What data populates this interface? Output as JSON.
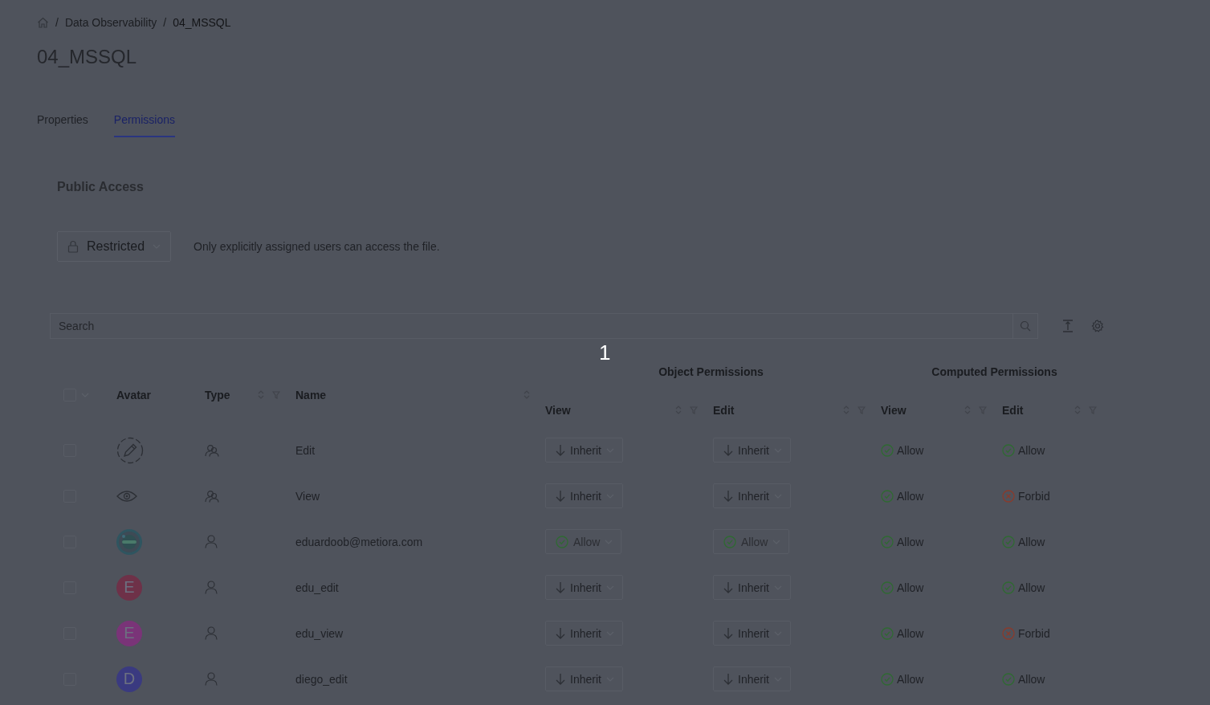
{
  "breadcrumb": [
    {
      "separator": "/",
      "label": "Data Observability"
    },
    {
      "separator": "/",
      "label": "04_MSSQL"
    }
  ],
  "title": "04_MSSQL",
  "tabs": [
    {
      "label": "Properties",
      "selected": false
    },
    {
      "label": "Permissions",
      "selected": true
    }
  ],
  "public_access": {
    "heading": "Public Access",
    "dropdown": {
      "value": "Restricted"
    },
    "description": "Only explicitly assigned users can access the file."
  },
  "search": {
    "placeholder": "Search"
  },
  "step_marker": "1",
  "table": {
    "select_all": {
      "checked": false
    },
    "columns": {
      "avatar": "Avatar",
      "type": "Type",
      "name": "Name"
    },
    "groups": [
      {
        "label": "Object Permissions",
        "columns": [
          "View",
          "Edit"
        ]
      },
      {
        "label": "Computed Permissions",
        "columns": [
          "View",
          "Edit"
        ]
      }
    ],
    "rows": [
      {
        "checked": false,
        "avatar": {
          "kind": "edit"
        },
        "kind": "group",
        "name": "Edit",
        "object": [
          {
            "kind": "inherit",
            "label": "Inherit",
            "disabled": false
          },
          {
            "kind": "inherit",
            "label": "Inherit",
            "disabled": false
          }
        ],
        "computed": [
          {
            "kind": "allow",
            "label": "Allow"
          },
          {
            "kind": "allow",
            "label": "Allow"
          }
        ]
      },
      {
        "checked": false,
        "avatar": {
          "kind": "view"
        },
        "kind": "group",
        "name": "View",
        "object": [
          {
            "kind": "inherit",
            "label": "Inherit",
            "disabled": false
          },
          {
            "kind": "inherit",
            "label": "Inherit",
            "disabled": false
          }
        ],
        "computed": [
          {
            "kind": "allow",
            "label": "Allow"
          },
          {
            "kind": "forbid",
            "label": "Forbid"
          }
        ]
      },
      {
        "checked": false,
        "kind": "user",
        "name": "eduardoob@metiora.com",
        "object": [
          {
            "kind": "allow",
            "label": "Allow",
            "disabled": true
          },
          {
            "kind": "allow",
            "label": "Allow",
            "disabled": true
          }
        ],
        "computed": [
          {
            "kind": "allow",
            "label": "Allow"
          },
          {
            "kind": "allow",
            "label": "Allow"
          }
        ]
      },
      {
        "checked": false,
        "avatar": {
          "kind": "letter",
          "letter": "E",
          "color": "#6e3148"
        },
        "kind": "user",
        "name": "edu_edit",
        "object": [
          {
            "kind": "inherit",
            "label": "Inherit",
            "disabled": false
          },
          {
            "kind": "inherit",
            "label": "Inherit",
            "disabled": false
          }
        ],
        "computed": [
          {
            "kind": "allow",
            "label": "Allow"
          },
          {
            "kind": "allow",
            "label": "Allow"
          }
        ]
      },
      {
        "checked": false,
        "avatar": {
          "kind": "letter",
          "letter": "E",
          "color": "#7a3478"
        },
        "kind": "user",
        "name": "edu_view",
        "object": [
          {
            "kind": "inherit",
            "label": "Inherit",
            "disabled": false
          },
          {
            "kind": "inherit",
            "label": "Inherit",
            "disabled": false
          }
        ],
        "computed": [
          {
            "kind": "allow",
            "label": "Allow"
          },
          {
            "kind": "forbid",
            "label": "Forbid"
          }
        ]
      },
      {
        "checked": false,
        "avatar": {
          "kind": "letter",
          "letter": "D",
          "color": "#3a3a80"
        },
        "kind": "user",
        "name": "diego_edit",
        "object": [
          {
            "kind": "inherit",
            "label": "Inherit",
            "disabled": false
          },
          {
            "kind": "inherit",
            "label": "Inherit",
            "disabled": false
          }
        ],
        "computed": [
          {
            "kind": "allow",
            "label": "Allow"
          },
          {
            "kind": "allow",
            "label": "Allow"
          }
        ]
      }
    ]
  }
}
